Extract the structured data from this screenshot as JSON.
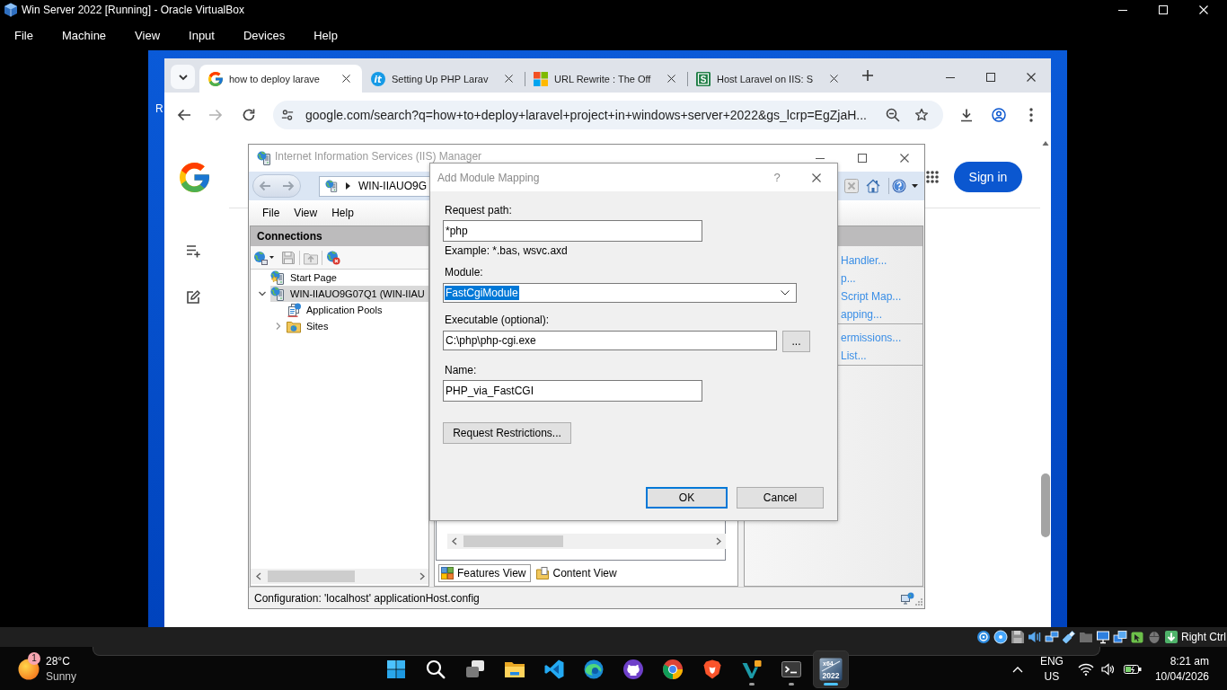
{
  "host_window": {
    "title": "Win Server 2022 [Running] - Oracle VirtualBox",
    "menu": [
      "File",
      "Machine",
      "View",
      "Input",
      "Devices",
      "Help"
    ]
  },
  "desktop": {
    "icon_label": "R"
  },
  "browser": {
    "tabs": [
      {
        "title": "how to deploy larave",
        "kind": "google",
        "selected": true
      },
      {
        "title": "Setting Up PHP Larav",
        "kind": "disc",
        "badge": "it",
        "selected": false
      },
      {
        "title": "URL Rewrite : The Off",
        "kind": "tiles",
        "selected": false
      },
      {
        "title": "Host Laravel on IIS: S",
        "kind": "square",
        "badge": "S",
        "selected": false
      }
    ],
    "address": "google.com/search?q=how+to+deploy+laravel+project+in+windows+server+2022&gs_lcrp=EgZjaH...",
    "forward_disabled": true,
    "sign_in": "Sign in"
  },
  "iis": {
    "title": "Internet Information Services (IIS) Manager",
    "breadcrumb": "WIN-IIAUO9G",
    "menu": [
      "File",
      "View",
      "Help"
    ],
    "connections": {
      "title": "Connections",
      "tree": [
        {
          "label": "Start Page",
          "kind": "start",
          "selected": false
        },
        {
          "label": "WIN-IIAUO9G07Q1 (WIN-IIAU",
          "kind": "server",
          "selected": true,
          "expanded": true,
          "children": [
            {
              "label": "Application Pools",
              "kind": "pools",
              "selected": false
            },
            {
              "label": "Sites",
              "kind": "sites",
              "selected": false,
              "expanded": false
            }
          ]
        }
      ]
    },
    "action_groups": [
      [
        "Handler...",
        "p...",
        "Script Map...",
        "apping..."
      ],
      [
        "ermissions...",
        "List..."
      ]
    ],
    "view_tabs": [
      {
        "label": "Features View",
        "kind": "features",
        "selected": true
      },
      {
        "label": "Content View",
        "kind": "content",
        "selected": false
      }
    ],
    "status": "Configuration: 'localhost' applicationHost.config"
  },
  "dialog": {
    "title": "Add Module Mapping",
    "help": "?",
    "request_path": {
      "label": "Request path:",
      "value": "*php",
      "example": "Example: *.bas, wsvc.axd"
    },
    "module": {
      "label": "Module:",
      "value": "FastCgiModule",
      "highlighted": true
    },
    "executable": {
      "label": "Executable (optional):",
      "value": "C:\\php\\php-cgi.exe",
      "browse": "..."
    },
    "name": {
      "label": "Name:",
      "value": "PHP_via_FastCGI"
    },
    "restrictions": "Request Restrictions...",
    "buttons": [
      {
        "label": "OK",
        "default": true
      },
      {
        "label": "Cancel",
        "default": false
      }
    ]
  },
  "vm_status": {
    "host_key": "Right Ctrl"
  },
  "taskbar": {
    "weather": {
      "badge": "1",
      "temperature": "28°C",
      "condition": "Sunny"
    },
    "apps": [
      {
        "kind": "start",
        "running": false,
        "selected": false
      },
      {
        "kind": "search",
        "running": false,
        "selected": false
      },
      {
        "kind": "tasks",
        "running": false,
        "selected": false
      },
      {
        "kind": "folder",
        "running": false,
        "selected": false
      },
      {
        "kind": "code",
        "running": false,
        "selected": false
      },
      {
        "kind": "edge",
        "running": false,
        "selected": false
      },
      {
        "kind": "github",
        "running": false,
        "selected": false
      },
      {
        "kind": "chrome",
        "running": false,
        "selected": false
      },
      {
        "kind": "brave",
        "running": false,
        "selected": false
      },
      {
        "kind": "studio",
        "running": true,
        "selected": false
      },
      {
        "kind": "terminal",
        "running": true,
        "selected": false
      },
      {
        "kind": "vbox",
        "running": true,
        "selected": true,
        "icon_text": [
          "x64",
          "2022"
        ]
      }
    ],
    "language": [
      "ENG",
      "US"
    ],
    "time": "8:21 am",
    "date": "10/04/2026"
  }
}
